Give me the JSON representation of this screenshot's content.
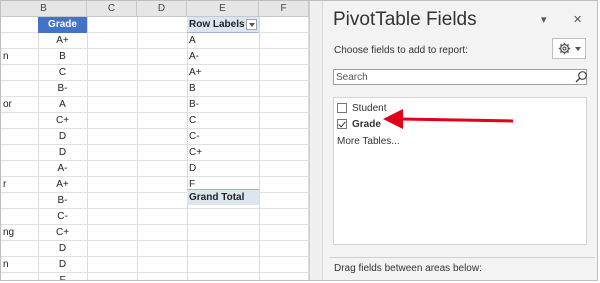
{
  "sheet": {
    "columns": [
      "B",
      "C",
      "D",
      "E",
      "F"
    ],
    "grade_header": "Grade",
    "row_fragments": [
      "",
      "n",
      "",
      "",
      "or",
      "",
      "",
      "",
      "",
      "r",
      "",
      "",
      "ng",
      "",
      "n",
      ""
    ],
    "grades": [
      "A+",
      "B",
      "C",
      "B-",
      "A",
      "C+",
      "D",
      "D",
      "A-",
      "A+",
      "B-",
      "C-",
      "C+",
      "D",
      "D",
      "F"
    ],
    "pivot": {
      "header": "Row Labels",
      "labels": [
        "A",
        "A-",
        "A+",
        "B",
        "B-",
        "C",
        "C-",
        "C+",
        "D",
        "F"
      ],
      "total_label": "Grand Total"
    }
  },
  "pane": {
    "title": "PivotTable Fields",
    "subtitle": "Choose fields to add to report:",
    "search_placeholder": "Search",
    "fields": [
      {
        "label": "Student",
        "checked": false
      },
      {
        "label": "Grade",
        "checked": true
      }
    ],
    "more_tables": "More Tables...",
    "drag_hint": "Drag fields between areas below:",
    "close_glyph": "✕",
    "dropdown_glyph": "▾"
  },
  "annotation": {
    "arrow_color": "#e3001b",
    "icon": "red-arrow-icon"
  }
}
